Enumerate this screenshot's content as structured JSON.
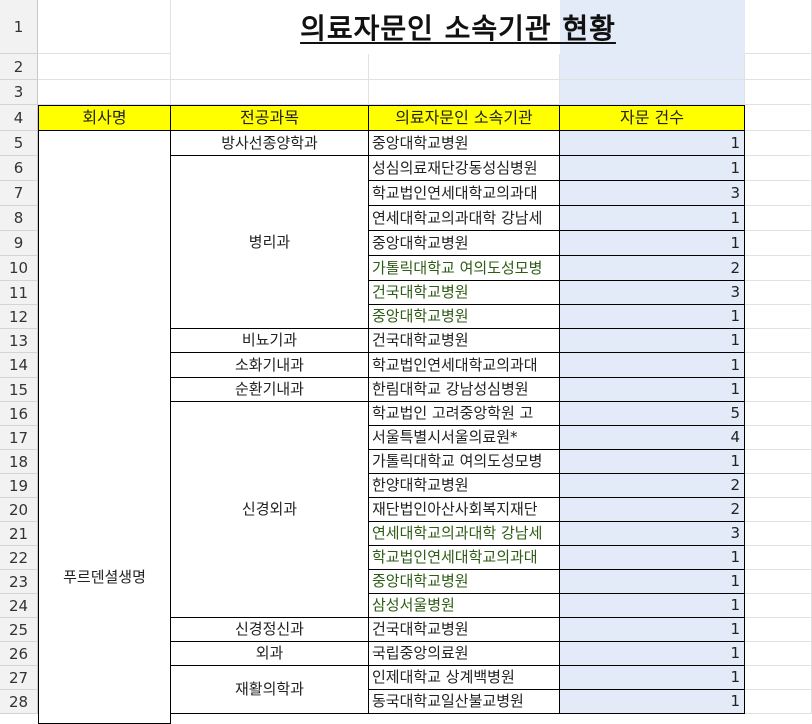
{
  "sheet": {
    "title": "의료자문인 소속기관 현황",
    "row_numbers": [
      "1",
      "2",
      "3",
      "4",
      "5",
      "6",
      "7",
      "8",
      "9",
      "10",
      "11",
      "12",
      "13",
      "14",
      "15",
      "16",
      "17",
      "18",
      "19",
      "20",
      "21",
      "22",
      "23",
      "24",
      "25",
      "26",
      "27",
      "28"
    ],
    "headers": {
      "company": "회사명",
      "department": "전공과목",
      "institution": "의료자문인 소속기관",
      "count": "자문 건수"
    },
    "company_name": "푸르덴셜생명",
    "departments": [
      {
        "name": "방사선종양학과",
        "start": 0,
        "span": 1
      },
      {
        "name": "병리과",
        "start": 1,
        "span": 7
      },
      {
        "name": "비뇨기과",
        "start": 8,
        "span": 1
      },
      {
        "name": "소화기내과",
        "start": 9,
        "span": 1
      },
      {
        "name": "순환기내과",
        "start": 10,
        "span": 1
      },
      {
        "name": "신경외과",
        "start": 11,
        "span": 9
      },
      {
        "name": "신경정신과",
        "start": 20,
        "span": 1
      },
      {
        "name": "외과",
        "start": 21,
        "span": 1
      },
      {
        "name": "재활의학과",
        "start": 22,
        "span": 2
      }
    ],
    "rows": [
      {
        "institution": "중앙대학교병원",
        "count": "1",
        "green": false
      },
      {
        "institution": "성심의료재단강동성심병원",
        "count": "1",
        "green": false
      },
      {
        "institution": "학교법인연세대학교의과대",
        "count": "3",
        "green": false
      },
      {
        "institution": "연세대학교의과대학 강남세",
        "count": "1",
        "green": false
      },
      {
        "institution": "중앙대학교병원",
        "count": "1",
        "green": false
      },
      {
        "institution": "가톨릭대학교 여의도성모병",
        "count": "2",
        "green": true
      },
      {
        "institution": "건국대학교병원",
        "count": "3",
        "green": true
      },
      {
        "institution": "중앙대학교병원",
        "count": "1",
        "green": true
      },
      {
        "institution": "건국대학교병원",
        "count": "1",
        "green": false
      },
      {
        "institution": "학교법인연세대학교의과대",
        "count": "1",
        "green": false
      },
      {
        "institution": "한림대학교 강남성심병원",
        "count": "1",
        "green": false
      },
      {
        "institution": "학교법인 고려중앙학원 고",
        "count": "5",
        "green": false
      },
      {
        "institution": "서울특별시서울의료원*",
        "count": "4",
        "green": false
      },
      {
        "institution": "가톨릭대학교 여의도성모병",
        "count": "1",
        "green": false
      },
      {
        "institution": "한양대학교병원",
        "count": "2",
        "green": false
      },
      {
        "institution": "재단법인아산사회복지재단",
        "count": "2",
        "green": false
      },
      {
        "institution": "연세대학교의과대학 강남세",
        "count": "3",
        "green": true
      },
      {
        "institution": "학교법인연세대학교의과대",
        "count": "1",
        "green": true
      },
      {
        "institution": "중앙대학교병원",
        "count": "1",
        "green": true
      },
      {
        "institution": "삼성서울병원",
        "count": "1",
        "green": true
      },
      {
        "institution": "건국대학교병원",
        "count": "1",
        "green": false
      },
      {
        "institution": "국립중앙의료원",
        "count": "1",
        "green": false
      },
      {
        "institution": "인제대학교 상계백병원",
        "count": "1",
        "green": false
      },
      {
        "institution": "동국대학교일산불교병원",
        "count": "1",
        "green": false
      }
    ]
  }
}
